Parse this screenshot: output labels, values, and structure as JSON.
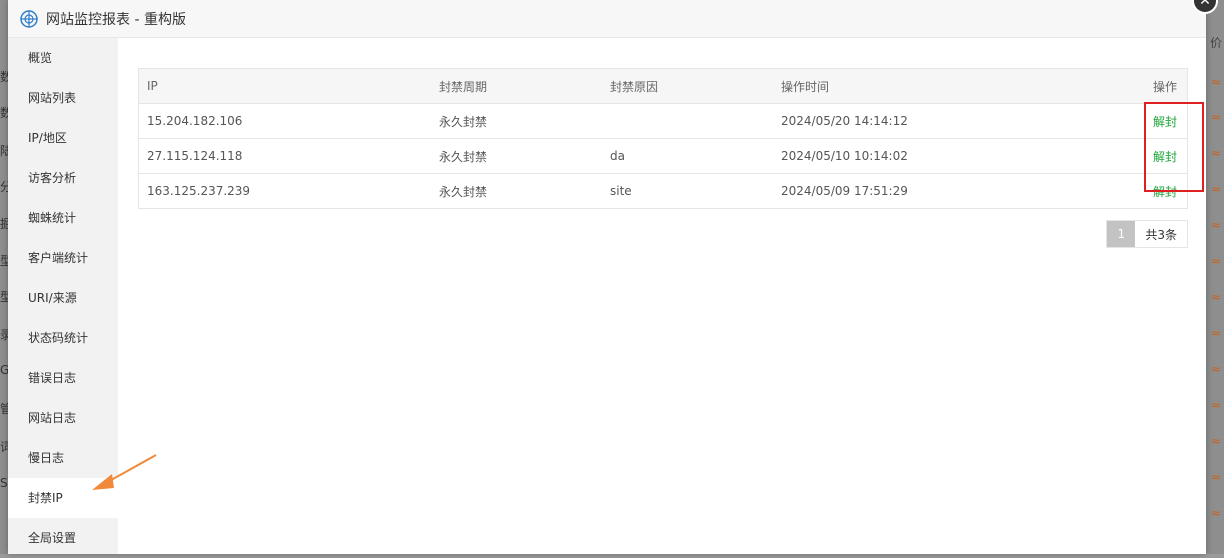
{
  "window": {
    "title": "网站监控报表 - 重构版",
    "close_icon": "close-icon"
  },
  "sidebar": {
    "items": [
      {
        "label": "概览"
      },
      {
        "label": "网站列表"
      },
      {
        "label": "IP/地区"
      },
      {
        "label": "访客分析"
      },
      {
        "label": "蜘蛛统计"
      },
      {
        "label": "客户端统计"
      },
      {
        "label": "URI/来源"
      },
      {
        "label": "状态码统计"
      },
      {
        "label": "错误日志"
      },
      {
        "label": "网站日志"
      },
      {
        "label": "慢日志"
      },
      {
        "label": "封禁IP",
        "active": true
      },
      {
        "label": "全局设置"
      }
    ]
  },
  "table": {
    "headers": [
      "IP",
      "封禁周期",
      "封禁原因",
      "操作时间",
      "操作"
    ],
    "rows": [
      {
        "ip": "15.204.182.106",
        "period": "永久封禁",
        "reason": "",
        "time": "2024/05/20 14:14:12",
        "action": "解封"
      },
      {
        "ip": "27.115.124.118",
        "period": "永久封禁",
        "reason": "da",
        "time": "2024/05/10 10:14:02",
        "action": "解封"
      },
      {
        "ip": "163.125.237.239",
        "period": "永久封禁",
        "reason": "site",
        "time": "2024/05/09 17:51:29",
        "action": "解封"
      }
    ]
  },
  "pagination": {
    "current_page": "1",
    "total_text": "共3条"
  },
  "colors": {
    "accent_green": "#20a53a",
    "highlight_red": "#e02020",
    "arrow_orange": "#f08a3a"
  }
}
